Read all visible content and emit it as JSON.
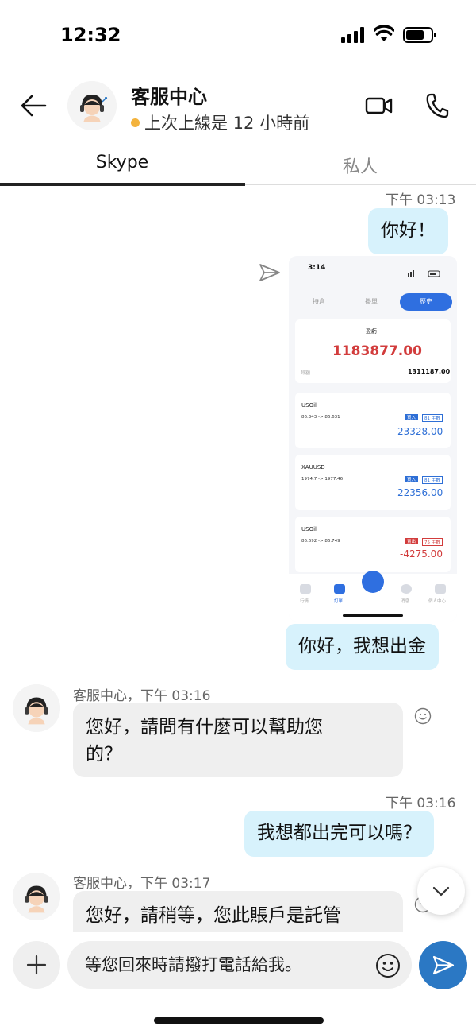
{
  "status_bar": {
    "time": "12:32"
  },
  "header": {
    "title": "客服中心",
    "status": "上次上線是 12 小時前"
  },
  "tabs": [
    {
      "label": "Skype"
    },
    {
      "label": "私人"
    }
  ],
  "messages": {
    "m1_time": "下午 03:13",
    "m1_text": "你好！",
    "m2_text": "你好，我想出金",
    "m3_sender": "客服中心，下午 03:16",
    "m3_text_line1": "您好，請問有什麼可以幫助您",
    "m3_text_line2": "的？",
    "m4_time": "下午 03:16",
    "m4_text": "我想都出完可以嗎？",
    "m5_sender": "客服中心，下午 03:17",
    "m5_text": "您好，請稍等，您此賬戶是託管"
  },
  "shared_image": {
    "time": "3:14",
    "tabs": [
      "持倉",
      "掛單",
      "歷史"
    ],
    "profit_label": "盈虧",
    "profit_value": "1183877.00",
    "balance_label": "餘額",
    "balance_value": "1311187.00",
    "trades": [
      {
        "symbol": "USOil",
        "prices": "86.343 -> 86.631",
        "side": "買入",
        "lots": "81 手數",
        "pnl": "23328.00",
        "color": "#2e6fd6"
      },
      {
        "symbol": "XAUUSD",
        "prices": "1974.7 -> 1977.46",
        "side": "買入",
        "lots": "81 手數",
        "pnl": "22356.00",
        "color": "#2e6fd6"
      },
      {
        "symbol": "USOil",
        "prices": "86.692 -> 86.749",
        "side": "賣出",
        "lots": "75 手數",
        "pnl": "-4275.00",
        "color": "#d23c3c"
      }
    ],
    "nav": [
      "行情",
      "訂單",
      "",
      "消息",
      "個人中心"
    ]
  },
  "composer": {
    "input_text": "等您回來時請撥打電話給我。"
  },
  "colors": {
    "outgoing_bubble": "#d7f2fc",
    "incoming_bubble": "#efefef",
    "accent": "#2b78c4",
    "online_dot": "#f3b33d"
  }
}
